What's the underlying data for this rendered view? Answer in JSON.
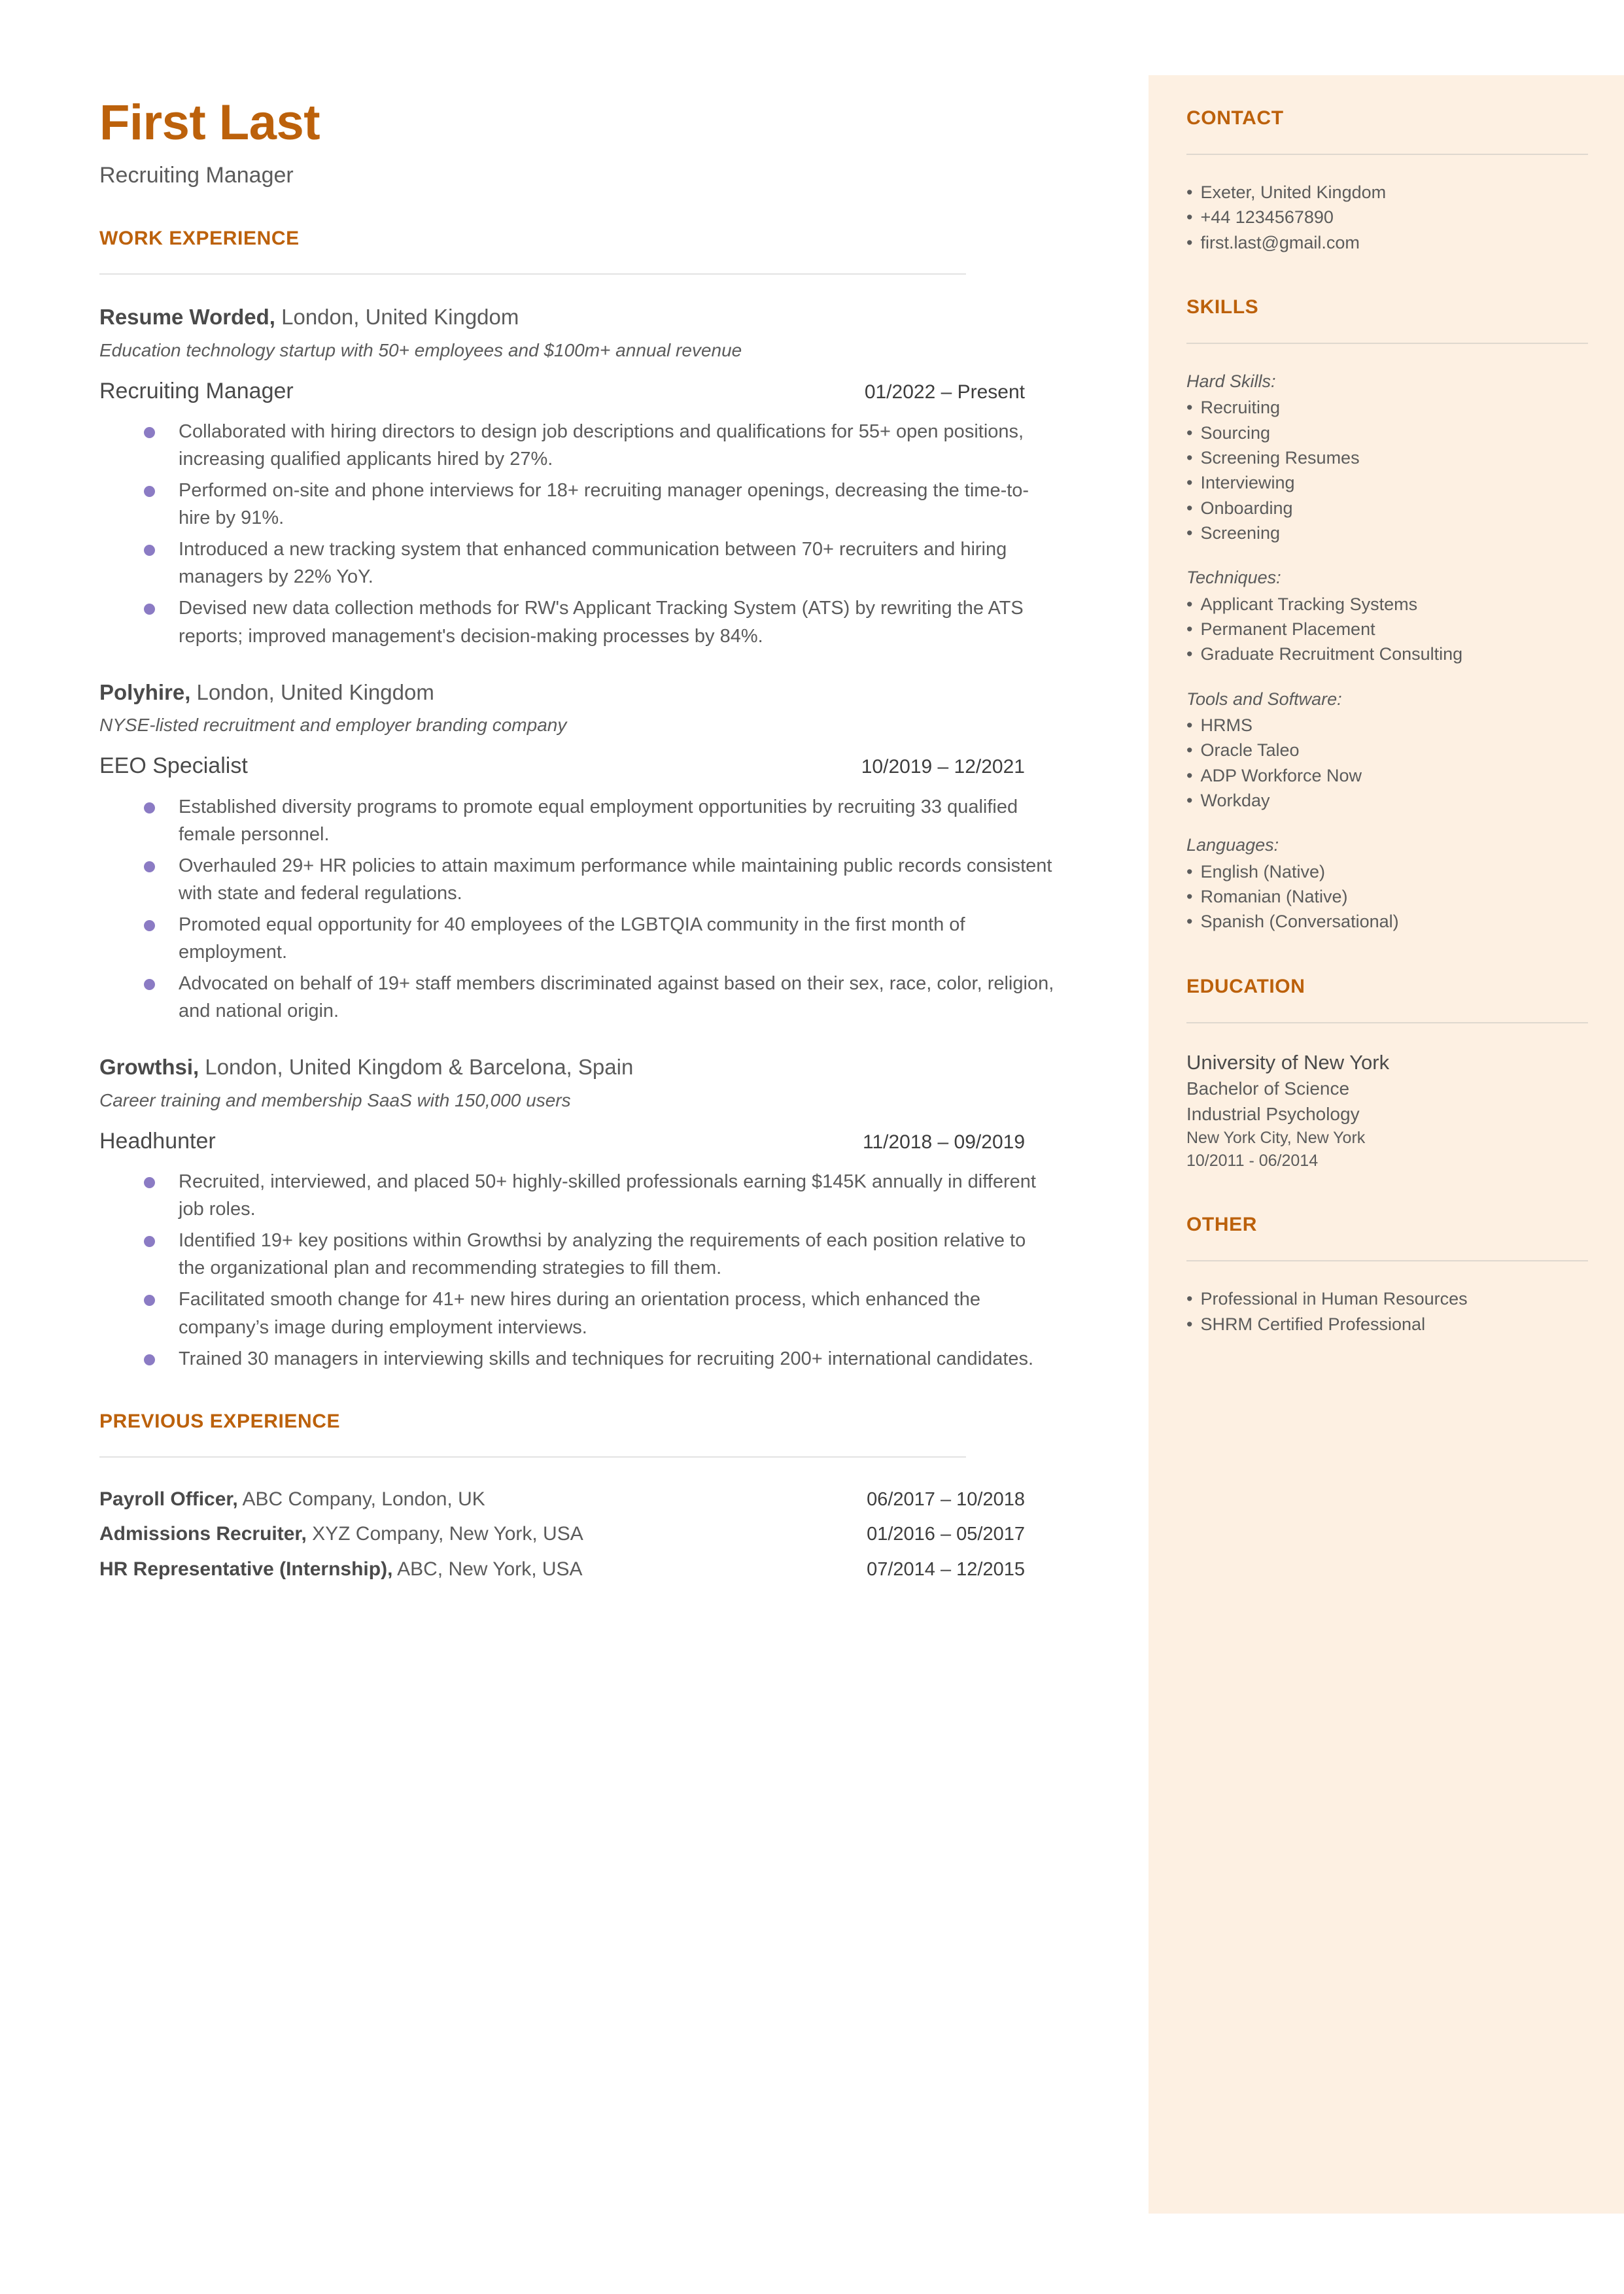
{
  "theme": {
    "accent": "#BC610B",
    "sidebar_bg": "#FDF0E2",
    "bullet": "#8B7BC4",
    "text": "#5b5b5b"
  },
  "header": {
    "name": "First Last",
    "title": "Recruiting Manager"
  },
  "main": {
    "work_experience_heading": "WORK EXPERIENCE",
    "previous_experience_heading": "PREVIOUS EXPERIENCE",
    "jobs": [
      {
        "company": "Resume Worded,",
        "location": " London, United Kingdom",
        "description": "Education technology startup with 50+ employees and $100m+ annual revenue",
        "title": "Recruiting Manager",
        "dates": "01/2022 – Present",
        "bullets": [
          "Collaborated with hiring directors to design job descriptions and qualifications for 55+ open positions, increasing qualified applicants hired by 27%.",
          "Performed on-site and phone interviews for 18+ recruiting manager openings, decreasing the time-to-hire by 91%.",
          "Introduced a new tracking system that enhanced communication between 70+ recruiters and hiring managers by 22% YoY.",
          "Devised new data collection methods for RW's Applicant Tracking System (ATS) by rewriting the ATS reports; improved management's decision-making processes by 84%."
        ]
      },
      {
        "company": "Polyhire,",
        "location": " London, United Kingdom",
        "description": "NYSE-listed recruitment and employer branding company",
        "title": "EEO Specialist",
        "dates": "10/2019 – 12/2021",
        "bullets": [
          "Established diversity programs to promote equal employment opportunities by recruiting 33 qualified female personnel.",
          "Overhauled 29+ HR policies to attain maximum performance while maintaining public records consistent with state and federal regulations.",
          "Promoted equal opportunity for 40 employees of the LGBTQIA community in the first month of employment.",
          "Advocated on behalf of 19+ staff members discriminated against based on their sex, race, color, religion, and national origin."
        ]
      },
      {
        "company": "Growthsi,",
        "location": " London, United Kingdom & Barcelona, Spain",
        "description": "Career training and membership SaaS with 150,000 users",
        "title": "Headhunter",
        "dates": "11/2018 – 09/2019",
        "bullets": [
          "Recruited, interviewed, and placed 50+ highly-skilled professionals earning $145K annually in different job roles.",
          "Identified 19+ key positions within Growthsi by analyzing the requirements of each position relative to the organizational plan and recommending strategies to fill them.",
          "Facilitated smooth change for 41+ new hires during an orientation process, which enhanced the company’s image during employment interviews.",
          "Trained 30 managers in interviewing skills and techniques for recruiting 200+ international candidates."
        ]
      }
    ],
    "previous_experience": [
      {
        "role": "Payroll Officer,",
        "detail": " ABC Company, London, UK",
        "dates": "06/2017 – 10/2018"
      },
      {
        "role": "Admissions Recruiter,",
        "detail": " XYZ Company, New York, USA",
        "dates": "01/2016 – 05/2017"
      },
      {
        "role": "HR Representative (Internship),",
        "detail": " ABC, New York, USA",
        "dates": "07/2014 – 12/2015"
      }
    ]
  },
  "sidebar": {
    "contact": {
      "heading": "CONTACT",
      "items": [
        "Exeter, United Kingdom",
        "+44 1234567890",
        "first.last@gmail.com"
      ]
    },
    "skills": {
      "heading": "SKILLS",
      "groups": [
        {
          "label": "Hard Skills:",
          "items": [
            "Recruiting",
            "Sourcing",
            "Screening Resumes",
            "Interviewing",
            "Onboarding",
            "Screening"
          ]
        },
        {
          "label": "Techniques:",
          "items": [
            "Applicant Tracking Systems",
            "Permanent Placement",
            "Graduate Recruitment Consulting"
          ]
        },
        {
          "label": "Tools and Software:",
          "items": [
            "HRMS",
            "Oracle Taleo",
            "ADP Workforce Now",
            "Workday"
          ]
        },
        {
          "label": "Languages:",
          "items": [
            "English (Native)",
            "Romanian (Native)",
            "Spanish (Conversational)"
          ]
        }
      ]
    },
    "education": {
      "heading": "EDUCATION",
      "school": "University of New York",
      "degree": "Bachelor of Science",
      "field": "Industrial Psychology",
      "location": "New York City, New York",
      "dates": "10/2011 - 06/2014"
    },
    "other": {
      "heading": "OTHER",
      "items": [
        "Professional in Human Resources",
        "SHRM Certified Professional"
      ]
    }
  }
}
